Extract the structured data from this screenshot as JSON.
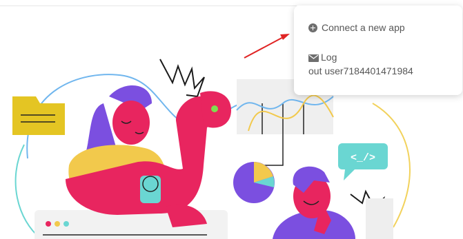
{
  "dropdown": {
    "connect_label": "Connect a new app",
    "logout_line1": "Log",
    "logout_line2": "out user7184401471984"
  },
  "illustration": {
    "code_tag": "<_/>"
  },
  "colors": {
    "pink": "#e8255f",
    "yellow": "#f2c94c",
    "purple": "#7b4fe0",
    "teal": "#6ad6d2",
    "arrow": "#e02424",
    "menu_text": "#565656"
  },
  "icons": [
    "plus-circle-icon",
    "mail-icon",
    "arrow-icon"
  ]
}
